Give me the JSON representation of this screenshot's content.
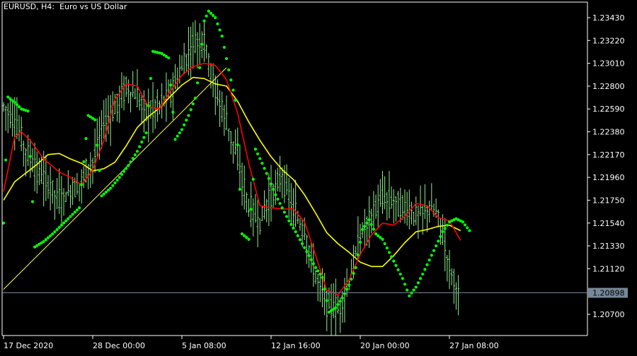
{
  "chart_data": {
    "type": "line",
    "title": "EURUSD, H4:  Euro vs US Dollar",
    "background": "#000000",
    "colors": {
      "candles": "#90ee90",
      "ma_fast": "#ff0000",
      "ma_slow": "#ffff00",
      "psar": "#00ff00",
      "trendline": "#ffff66",
      "axis": "#ffffff",
      "bid_line": "#778899",
      "bid_label_bg": "#778899",
      "bid_label_text": "#000000"
    },
    "x_axis": {
      "tick_labels": [
        "17 Dec 2020",
        "28 Dec 00:00",
        "5 Jan 08:00",
        "12 Jan 16:00",
        "20 Jan 00:00",
        "27 Jan 08:00"
      ],
      "tick_bars": [
        0,
        40,
        80,
        120,
        160,
        200
      ],
      "bar_count": 206
    },
    "y_axis": {
      "ylim": [
        1.2061,
        1.2356
      ],
      "ticks": [
        "1.23430",
        "1.23220",
        "1.23010",
        "1.22800",
        "1.22590",
        "1.22380",
        "1.22170",
        "1.21960",
        "1.21750",
        "1.21540",
        "1.21330",
        "1.21120",
        "1.20700"
      ]
    },
    "current_price": "1.20898",
    "series": [
      {
        "name": "",
        "kind": "price",
        "points": [
          [
            0,
            1.2262
          ],
          [
            5,
            1.2248
          ],
          [
            10,
            1.222
          ],
          [
            15,
            1.2202
          ],
          [
            20,
            1.219
          ],
          [
            25,
            1.2175
          ],
          [
            30,
            1.2183
          ],
          [
            35,
            1.2193
          ],
          [
            40,
            1.2211
          ],
          [
            45,
            1.2247
          ],
          [
            50,
            1.226
          ],
          [
            55,
            1.228
          ],
          [
            60,
            1.2268
          ],
          [
            65,
            1.2256
          ],
          [
            70,
            1.2263
          ],
          [
            75,
            1.2274
          ],
          [
            80,
            1.2296
          ],
          [
            85,
            1.232
          ],
          [
            90,
            1.2322
          ],
          [
            95,
            1.2275
          ],
          [
            100,
            1.2248
          ],
          [
            105,
            1.2213
          ],
          [
            110,
            1.2167
          ],
          [
            115,
            1.2155
          ],
          [
            120,
            1.218
          ],
          [
            125,
            1.2199
          ],
          [
            130,
            1.2165
          ],
          [
            135,
            1.2145
          ],
          [
            140,
            1.2105
          ],
          [
            145,
            1.2082
          ],
          [
            150,
            1.2073
          ],
          [
            155,
            1.21
          ],
          [
            160,
            1.2142
          ],
          [
            165,
            1.216
          ],
          [
            170,
            1.2178
          ],
          [
            175,
            1.2175
          ],
          [
            180,
            1.2168
          ],
          [
            185,
            1.216
          ],
          [
            190,
            1.2168
          ],
          [
            195,
            1.2162
          ],
          [
            200,
            1.2114
          ],
          [
            204,
            1.209
          ]
        ]
      },
      {
        "name": "",
        "kind": "ma_fast",
        "points": [
          [
            0,
            1.2183
          ],
          [
            5,
            1.2233
          ],
          [
            8,
            1.2238
          ],
          [
            12,
            1.223
          ],
          [
            18,
            1.2213
          ],
          [
            25,
            1.2201
          ],
          [
            30,
            1.2196
          ],
          [
            35,
            1.2189
          ],
          [
            40,
            1.2203
          ],
          [
            45,
            1.223
          ],
          [
            50,
            1.2268
          ],
          [
            55,
            1.2282
          ],
          [
            60,
            1.228
          ],
          [
            65,
            1.2261
          ],
          [
            70,
            1.2259
          ],
          [
            75,
            1.2276
          ],
          [
            80,
            1.229
          ],
          [
            85,
            1.2298
          ],
          [
            90,
            1.2301
          ],
          [
            95,
            1.2299
          ],
          [
            100,
            1.2286
          ],
          [
            105,
            1.2255
          ],
          [
            110,
            1.2209
          ],
          [
            115,
            1.217
          ],
          [
            120,
            1.2168
          ],
          [
            125,
            1.2167
          ],
          [
            130,
            1.2167
          ],
          [
            135,
            1.2155
          ],
          [
            140,
            1.2124
          ],
          [
            145,
            1.2092
          ],
          [
            150,
            1.2088
          ],
          [
            155,
            1.2102
          ],
          [
            160,
            1.2125
          ],
          [
            165,
            1.2143
          ],
          [
            170,
            1.2154
          ],
          [
            175,
            1.2152
          ],
          [
            180,
            1.216
          ],
          [
            185,
            1.2172
          ],
          [
            190,
            1.217
          ],
          [
            195,
            1.2159
          ],
          [
            200,
            1.2156
          ],
          [
            205,
            1.2138
          ]
        ]
      },
      {
        "name": "",
        "kind": "ma_slow",
        "points": [
          [
            0,
            1.2175
          ],
          [
            5,
            1.2192
          ],
          [
            10,
            1.22
          ],
          [
            15,
            1.2208
          ],
          [
            20,
            1.2217
          ],
          [
            25,
            1.2218
          ],
          [
            30,
            1.2213
          ],
          [
            35,
            1.2209
          ],
          [
            40,
            1.2202
          ],
          [
            45,
            1.2204
          ],
          [
            50,
            1.221
          ],
          [
            55,
            1.2225
          ],
          [
            60,
            1.2242
          ],
          [
            65,
            1.2252
          ],
          [
            70,
            1.226
          ],
          [
            75,
            1.2271
          ],
          [
            80,
            1.2281
          ],
          [
            85,
            1.2288
          ],
          [
            90,
            1.2287
          ],
          [
            95,
            1.2282
          ],
          [
            100,
            1.228
          ],
          [
            105,
            1.2266
          ],
          [
            110,
            1.2247
          ],
          [
            115,
            1.223
          ],
          [
            120,
            1.2215
          ],
          [
            125,
            1.2203
          ],
          [
            130,
            1.2194
          ],
          [
            135,
            1.218
          ],
          [
            140,
            1.2163
          ],
          [
            145,
            1.2145
          ],
          [
            150,
            1.2135
          ],
          [
            155,
            1.2127
          ],
          [
            160,
            1.2118
          ],
          [
            165,
            1.2114
          ],
          [
            170,
            1.2114
          ],
          [
            175,
            1.2124
          ],
          [
            180,
            1.2136
          ],
          [
            185,
            1.2146
          ],
          [
            190,
            1.2148
          ],
          [
            195,
            1.2151
          ],
          [
            200,
            1.2152
          ],
          [
            205,
            1.2147
          ]
        ]
      },
      {
        "name": "",
        "kind": "psar",
        "points": [
          [
            0,
            1.2154
          ],
          [
            2,
            1.227
          ],
          [
            5,
            1.2265
          ],
          [
            8,
            1.2259
          ],
          [
            11,
            1.2257
          ],
          [
            14,
            1.2132
          ],
          [
            18,
            1.2137
          ],
          [
            22,
            1.2144
          ],
          [
            26,
            1.2152
          ],
          [
            30,
            1.216
          ],
          [
            34,
            1.2168
          ],
          [
            38,
            1.2253
          ],
          [
            41,
            1.2249
          ],
          [
            44,
            1.2179
          ],
          [
            48,
            1.2186
          ],
          [
            52,
            1.2196
          ],
          [
            56,
            1.2207
          ],
          [
            60,
            1.222
          ],
          [
            64,
            1.2237
          ],
          [
            67,
            1.2312
          ],
          [
            71,
            1.231
          ],
          [
            74,
            1.2306
          ],
          [
            77,
            1.2231
          ],
          [
            80,
            1.224
          ],
          [
            83,
            1.2253
          ],
          [
            86,
            1.2269
          ],
          [
            88,
            1.2297
          ],
          [
            90,
            1.234
          ],
          [
            92,
            1.2349
          ],
          [
            95,
            1.2343
          ],
          [
            98,
            1.2326
          ],
          [
            101,
            1.2295
          ],
          [
            104,
            1.2267
          ],
          [
            107,
            1.2144
          ],
          [
            110,
            1.2139
          ],
          [
            113,
            1.2222
          ],
          [
            116,
            1.2209
          ],
          [
            119,
            1.2195
          ],
          [
            122,
            1.218
          ],
          [
            125,
            1.2168
          ],
          [
            128,
            1.2156
          ],
          [
            131,
            1.2146
          ],
          [
            134,
            1.2135
          ],
          [
            137,
            1.2124
          ],
          [
            140,
            1.2113
          ],
          [
            143,
            1.2104
          ],
          [
            146,
            1.2072
          ],
          [
            149,
            1.2076
          ],
          [
            152,
            1.2085
          ],
          [
            155,
            1.2097
          ],
          [
            158,
            1.2113
          ],
          [
            161,
            1.2148
          ],
          [
            164,
            1.2157
          ],
          [
            167,
            1.2144
          ],
          [
            170,
            1.2139
          ],
          [
            173,
            1.2127
          ],
          [
            176,
            1.2115
          ],
          [
            179,
            1.2103
          ],
          [
            182,
            1.2087
          ],
          [
            185,
            1.2095
          ],
          [
            188,
            1.2107
          ],
          [
            191,
            1.212
          ],
          [
            194,
            1.2133
          ],
          [
            197,
            1.2146
          ],
          [
            200,
            1.2155
          ],
          [
            203,
            1.2158
          ],
          [
            206,
            1.2155
          ],
          [
            209,
            1.2147
          ]
        ]
      },
      {
        "name": "",
        "kind": "trendline",
        "points": [
          [
            0,
            1.2093
          ],
          [
            100,
            1.2297
          ]
        ]
      }
    ]
  }
}
